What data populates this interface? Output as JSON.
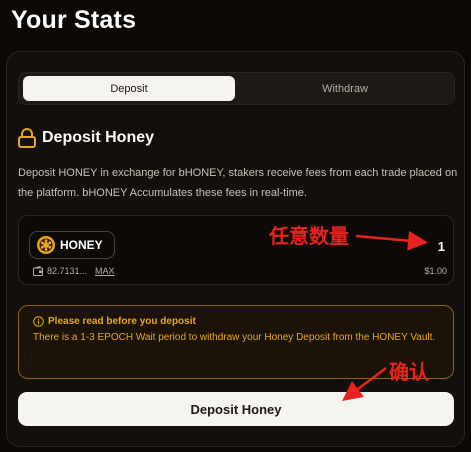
{
  "page": {
    "title": "Your Stats"
  },
  "tabs": [
    {
      "label": "Deposit",
      "active": true
    },
    {
      "label": "Withdraw",
      "active": false
    }
  ],
  "section": {
    "title": "Deposit Honey",
    "icon": "lock-icon"
  },
  "description": "Deposit HONEY in exchange for bHONEY, stakers receive fees from each trade placed on the platform. bHONEY Accumulates these fees in real-time.",
  "input_card": {
    "token": "HONEY",
    "token_icon": "honey-icon",
    "balance": "82.7131...",
    "max_label": "MAX",
    "amount": "1",
    "usd_value": "$1.00"
  },
  "notice": {
    "title": "Please read before you deposit",
    "body": "There is a 1-3 EPOCH Wait period to withdraw your Honey Deposit from the HONEY Vault."
  },
  "deposit_button": {
    "label": "Deposit Honey"
  },
  "annotations": {
    "quantity": "任意数量",
    "confirm": "确认",
    "color": "#e8231f"
  },
  "colors": {
    "background": "#0b0806",
    "panel": "#130f0c",
    "accent": "#e8a51f",
    "button": "#f6f4ef"
  }
}
